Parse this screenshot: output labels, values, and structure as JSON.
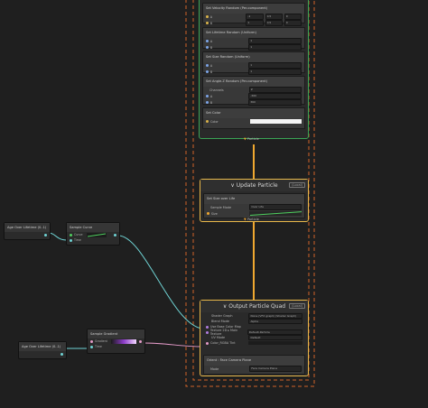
{
  "spawn_context": {
    "blocks": [
      {
        "title": "Set Velocity Random (Per-component)",
        "rows": [
          {
            "label": "A",
            "values": [
              "-1",
              "0.5",
              "0"
            ]
          },
          {
            "label": "B",
            "values": [
              "1",
              "0.5",
              "0"
            ]
          }
        ]
      },
      {
        "title": "Set Lifetime Random (Uniform)",
        "rows": [
          {
            "label": "A",
            "value": "1"
          },
          {
            "label": "B",
            "value": "1"
          }
        ]
      },
      {
        "title": "Set Size Random (Uniform)",
        "rows": [
          {
            "label": "A",
            "value": "1"
          },
          {
            "label": "B",
            "value": "1"
          }
        ]
      },
      {
        "title": "Set Angle.Z Random (Per-component)",
        "rows": [
          {
            "label": "Channels",
            "value": "Z"
          },
          {
            "label": "A",
            "value": "-360"
          },
          {
            "label": "B",
            "value": "360"
          }
        ]
      },
      {
        "title": "Set Color",
        "rows": [
          {
            "label": "Color",
            "value": ""
          }
        ]
      }
    ],
    "flow_out": "Particle"
  },
  "update_context": {
    "title": "Update Particle",
    "tag": "(Local)",
    "flow_in": "Particle",
    "flow_out": "Particle",
    "block": {
      "title": "Set Size over Life",
      "rows": [
        {
          "label": "Sample Mode",
          "value": "Over Life"
        },
        {
          "label": "Size",
          "value": ""
        }
      ]
    }
  },
  "output_context": {
    "title": "Output Particle Quad",
    "tag": "(Local)",
    "flow_in": "Particle",
    "settings": [
      {
        "label": "Shader Graph",
        "value": "None (VFX graph) (Shader Graph)"
      },
      {
        "label": "Blend Mode",
        "value": "Alpha"
      },
      {
        "label": "Use Base Color Map",
        "value": ""
      },
      {
        "label": "Texture 2D ▸ Main Texture",
        "value": "Default-Particle"
      },
      {
        "label": "UV Mode",
        "value": "Default"
      },
      {
        "label": "Color_RGBA Tint",
        "value": ""
      }
    ],
    "block": {
      "title": "Orient : Face Camera Plane",
      "rows": [
        {
          "label": "Mode",
          "value": "Face Camera Plane"
        }
      ]
    }
  },
  "nodes": {
    "age_over_lifetime_1": {
      "title": "Age Over Lifetime (0..1)"
    },
    "sample_curve": {
      "title": "Sample Curve",
      "inputs": [
        "Curve",
        "Time"
      ]
    },
    "age_over_lifetime_2": {
      "title": "Age Over Lifetime (0..1)"
    },
    "sample_gradient": {
      "title": "Sample Gradient",
      "inputs": [
        "Gradient",
        "Time"
      ]
    }
  },
  "colors": {
    "context_border": "#e8b84a",
    "spawn_border": "#3aa455",
    "system_dash": "#d1632a",
    "flow_wire": "#f0a830",
    "curve_wire": "#6fd3d4",
    "gradient_wire": "#e59bc9",
    "curve": "#4fd05f"
  }
}
